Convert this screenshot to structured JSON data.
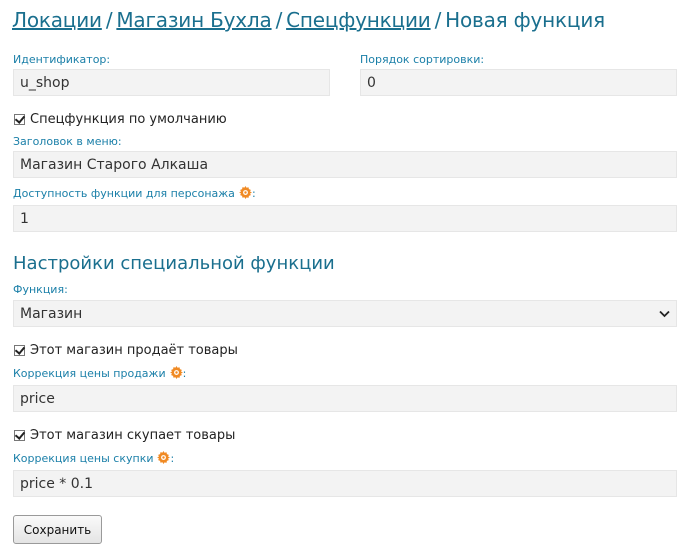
{
  "breadcrumb": {
    "items": [
      "Локации",
      "Магазин Бухла",
      "Спецфункции"
    ],
    "current": "Новая функция",
    "separator": "/"
  },
  "form": {
    "identifier_label": "Идентификатор:",
    "identifier_value": "u_shop",
    "sort_label": "Порядок сортировки:",
    "sort_value": "0",
    "default_check_label": "Спецфункция по умолчанию",
    "menu_title_label": "Заголовок в меню:",
    "menu_title_value": "Магазин Старого Алкаша",
    "availability_label": "Доступность функции для персонажа",
    "availability_value": "1"
  },
  "settings": {
    "heading": "Настройки специальной функции",
    "function_label": "Функция:",
    "function_value": "Магазин",
    "sells_label": "Этот магазин продаёт товары",
    "sell_price_label": "Коррекция цены продажи",
    "sell_price_value": "price",
    "buys_label": "Этот магазин скупает товары",
    "buy_price_label": "Коррекция цены скупки",
    "buy_price_value": "price * 0.1"
  },
  "save_button": "Сохранить",
  "colors": {
    "link": "#1a6f8e",
    "label": "#1a7fa8",
    "gear": "#f08a24"
  },
  "icons": {
    "formula_help": "gear-icon",
    "select_arrow": "chevron-down-icon"
  }
}
